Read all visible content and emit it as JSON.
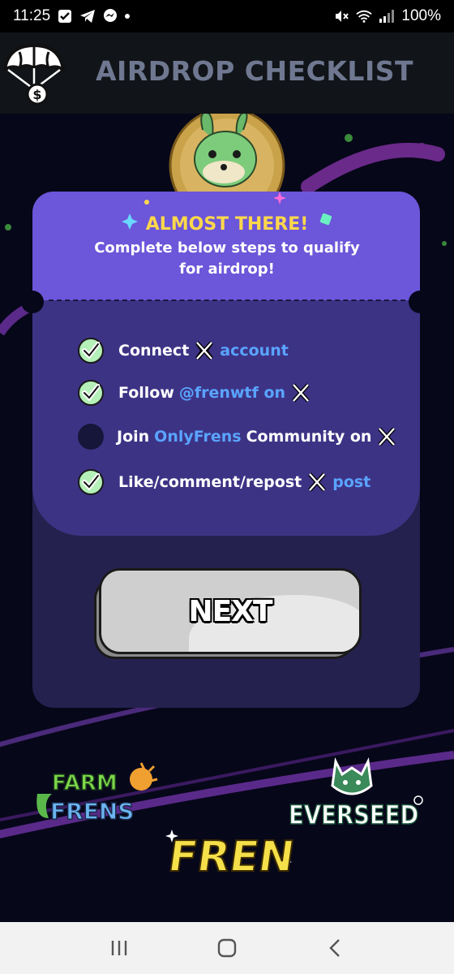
{
  "status_bar": {
    "time": "11:25",
    "battery": "100%",
    "icons": [
      "gmail-check-icon",
      "telegram-icon",
      "messenger-icon",
      "mute-icon",
      "wifi-icon",
      "signal-icon"
    ]
  },
  "header": {
    "title": "AIRDROP CHECKLIST",
    "logo_icon": "parachute-money-icon"
  },
  "card": {
    "heading": "ALMOST THERE!",
    "subtitle_line1": "Complete below steps to qualify",
    "subtitle_line2": "for airdrop!"
  },
  "steps": [
    {
      "completed": true,
      "parts": [
        "Connect",
        "account"
      ]
    },
    {
      "completed": true,
      "parts": [
        "Follow",
        "@frenwtf on"
      ]
    },
    {
      "completed": false,
      "parts": [
        "Join",
        "OnlyFrens",
        "Community on"
      ]
    },
    {
      "completed": true,
      "parts": [
        "Like/comment/repost",
        "post"
      ]
    }
  ],
  "next_button": {
    "label": "NEXT"
  },
  "partners": {
    "farm_frens_line1": "FARM",
    "farm_frens_line2": "FRENS",
    "fren": "FREN",
    "everseed": "EVERSEED"
  },
  "colors": {
    "accent_yellow": "#ffd84a",
    "link_blue": "#5aa4ff",
    "card_top": "#6c56d9",
    "card_mid": "#3d3385",
    "card_bottom": "#25214f",
    "check_green": "#b4f0b8"
  },
  "nav_bar": {
    "icons": [
      "recent-apps-icon",
      "home-icon",
      "back-icon"
    ]
  }
}
